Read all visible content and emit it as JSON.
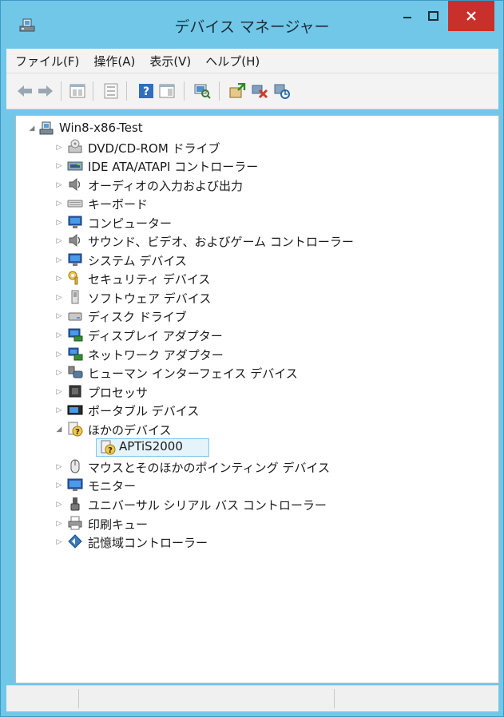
{
  "window": {
    "title": "デバイス マネージャー"
  },
  "menu": [
    "ファイル(F)",
    "操作(A)",
    "表示(V)",
    "ヘルプ(H)"
  ],
  "tree": {
    "root": "Win8-x86-Test",
    "items": [
      {
        "label": "DVD/CD-ROM ドライブ",
        "icon": "dvd-drive-icon"
      },
      {
        "label": "IDE ATA/ATAPI コントローラー",
        "icon": "ide-controller-icon"
      },
      {
        "label": "オーディオの入力および出力",
        "icon": "speaker-icon"
      },
      {
        "label": "キーボード",
        "icon": "keyboard-icon"
      },
      {
        "label": "コンピューター",
        "icon": "computer-icon"
      },
      {
        "label": "サウンド、ビデオ、およびゲーム コントローラー",
        "icon": "speaker-icon"
      },
      {
        "label": "システム デバイス",
        "icon": "computer-icon"
      },
      {
        "label": "セキュリティ デバイス",
        "icon": "key-icon"
      },
      {
        "label": "ソフトウェア デバイス",
        "icon": "software-device-icon"
      },
      {
        "label": "ディスク ドライブ",
        "icon": "disk-drive-icon"
      },
      {
        "label": "ディスプレイ アダプター",
        "icon": "display-adapter-icon"
      },
      {
        "label": "ネットワーク アダプター",
        "icon": "network-adapter-icon"
      },
      {
        "label": "ヒューマン インターフェイス デバイス",
        "icon": "hid-icon"
      },
      {
        "label": "プロセッサ",
        "icon": "processor-icon"
      },
      {
        "label": "ポータブル デバイス",
        "icon": "portable-device-icon"
      },
      {
        "label": "ほかのデバイス",
        "icon": "unknown-device-icon"
      },
      {
        "label": "APTiS2000",
        "icon": "unknown-device-icon"
      },
      {
        "label": "マウスとそのほかのポインティング デバイス",
        "icon": "mouse-icon"
      },
      {
        "label": "モニター",
        "icon": "monitor-icon"
      },
      {
        "label": "ユニバーサル シリアル バス コントローラー",
        "icon": "usb-icon"
      },
      {
        "label": "印刷キュー",
        "icon": "printer-icon"
      },
      {
        "label": "記憶域コントローラー",
        "icon": "storage-controller-icon"
      }
    ]
  }
}
